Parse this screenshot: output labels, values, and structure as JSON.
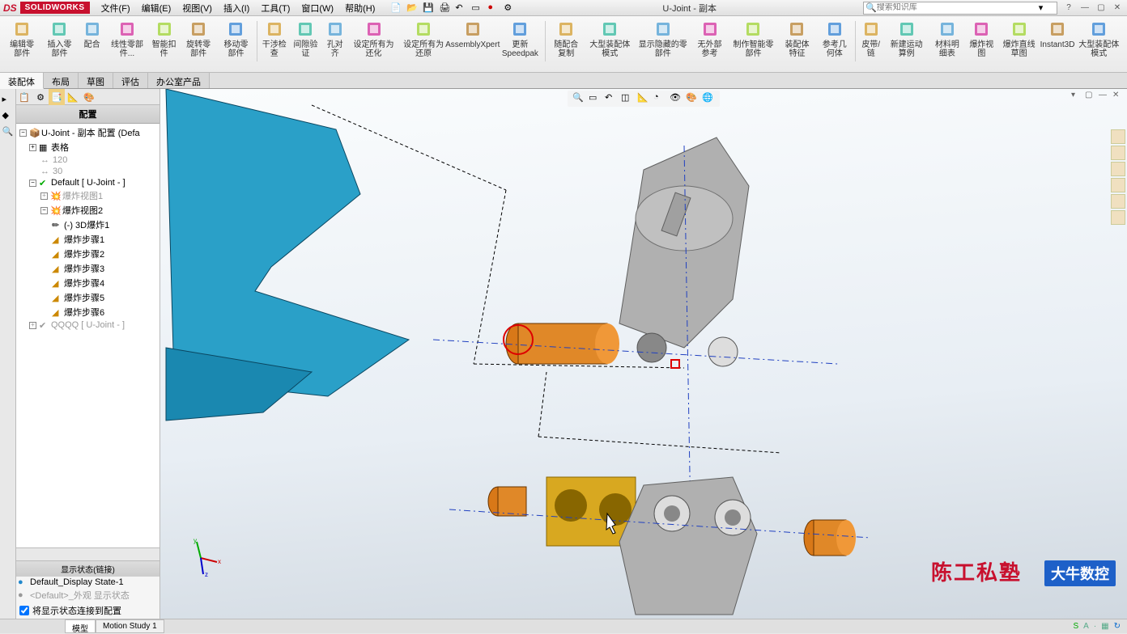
{
  "app": {
    "brand": "SOLIDWORKS",
    "document_title": "U-Joint - 副本"
  },
  "menu": {
    "file": "文件(F)",
    "edit": "编辑(E)",
    "view": "视图(V)",
    "insert": "插入(I)",
    "tools": "工具(T)",
    "window": "窗口(W)",
    "help": "帮助(H)"
  },
  "search": {
    "placeholder": "搜索知识库"
  },
  "ribbon": {
    "buttons": [
      "编辑零部件",
      "插入零部件",
      "配合",
      "线性零部件...",
      "智能扣件",
      "旋转零部件",
      "移动零部件",
      "干涉检查",
      "间隙验证",
      "孔对齐",
      "设定所有为还化",
      "设定所有为还原",
      "AssemblyXpert",
      "更新Speedpak",
      "随配合复制",
      "大型装配体模式",
      "显示隐藏的零部件",
      "无外部参考",
      "制作智能零部件",
      "装配体特征",
      "参考几何体",
      "皮带/链",
      "新建运动算例",
      "材料明细表",
      "爆炸视图",
      "爆炸直线草图",
      "Instant3D",
      "大型装配体模式"
    ]
  },
  "tabs": {
    "items": [
      "装配体",
      "布局",
      "草图",
      "评估",
      "办公室产品"
    ],
    "active": 0
  },
  "feature_panel": {
    "header": "配置",
    "root": "U-Joint - 副本 配置 (Defa",
    "items": {
      "table": "表格",
      "dim1": "120",
      "dim2": "30",
      "default": "Default [ U-Joint - ]",
      "exploded1": "爆炸视图1",
      "exploded2": "爆炸视图2",
      "explode3d": "(-) 3D爆炸1",
      "step1": "爆炸步骤1",
      "step2": "爆炸步骤2",
      "step3": "爆炸步骤3",
      "step4": "爆炸步骤4",
      "step5": "爆炸步骤5",
      "step6": "爆炸步骤6",
      "qqqq": "QQQQ [ U-Joint - ]"
    },
    "display_state_header": "显示状态(链接)",
    "display_state1": "Default_Display State-1",
    "display_state2": "<Default>_外观 显示状态",
    "checkbox_label": "将显示状态连接到配置"
  },
  "footer": {
    "tabs": [
      "模型",
      "Motion Study 1"
    ],
    "active": 0
  },
  "watermarks": {
    "w1": "陈工私塾",
    "w2": "大牛数控"
  }
}
